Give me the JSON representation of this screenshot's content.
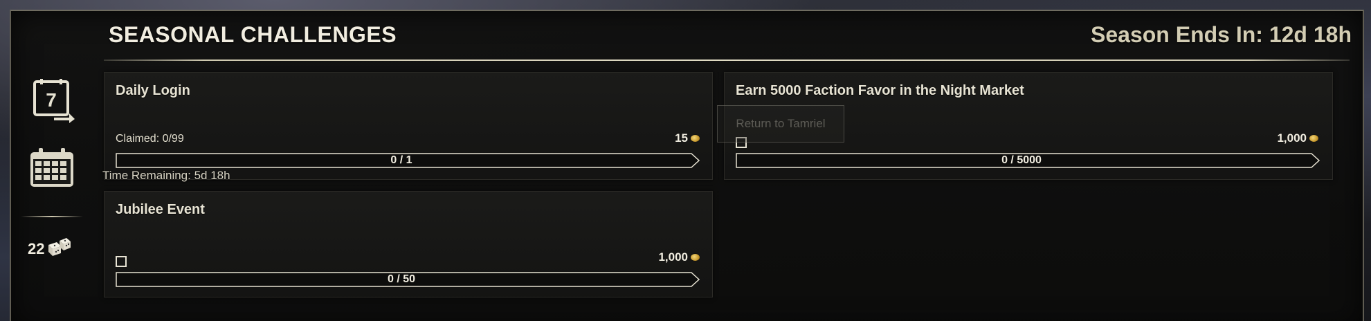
{
  "header": {
    "title": "SEASONAL CHALLENGES",
    "season_ends": "Season Ends In: 12d 18h"
  },
  "rail": {
    "calendar_day": "7",
    "token_count": "22",
    "icons": [
      "calendar-seven-day-icon",
      "calendar-grid-icon",
      "dice-icon"
    ]
  },
  "challenges": [
    {
      "title": "Daily Login",
      "claimed": "Claimed: 0/99",
      "reward": "15",
      "progress": "0 / 1",
      "progress_fraction": 0,
      "time_remaining": "Time Remaining: 5d 18h"
    },
    {
      "title": "Earn 5000 Faction Favor in the Night Market",
      "reward": "1,000",
      "progress": "0 / 5000",
      "progress_fraction": 0,
      "completed": false
    },
    {
      "title": "Jubilee Event",
      "reward": "1,000",
      "progress": "0 / 50",
      "progress_fraction": 0,
      "completed": false
    }
  ],
  "tooltip": {
    "text": "Return to Tamriel"
  },
  "colors": {
    "text": "#e8e4d4",
    "gold": "#c99a2e",
    "panel": "#121211"
  }
}
